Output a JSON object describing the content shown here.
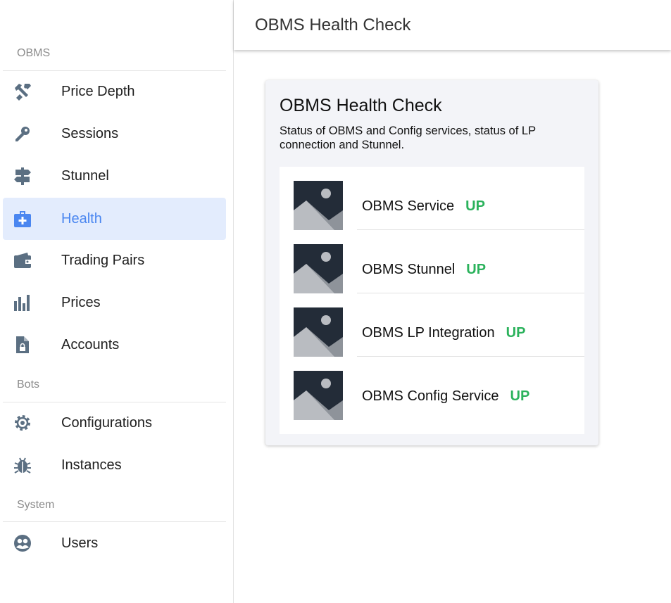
{
  "sidebar": {
    "sections": [
      {
        "title": "OBMS",
        "items": [
          {
            "label": "Price Depth",
            "icon": "tools-icon"
          },
          {
            "label": "Sessions",
            "icon": "key-icon"
          },
          {
            "label": "Stunnel",
            "icon": "signpost-icon"
          },
          {
            "label": "Health",
            "icon": "medical-bag-icon",
            "active": true
          },
          {
            "label": "Trading Pairs",
            "icon": "wallet-icon"
          },
          {
            "label": "Prices",
            "icon": "bar-chart-icon"
          },
          {
            "label": "Accounts",
            "icon": "file-lock-icon"
          }
        ]
      },
      {
        "title": "Bots",
        "items": [
          {
            "label": "Configurations",
            "icon": "gear-icon"
          },
          {
            "label": "Instances",
            "icon": "bug-icon"
          }
        ]
      },
      {
        "title": "System",
        "items": [
          {
            "label": "Users",
            "icon": "users-icon"
          }
        ]
      }
    ]
  },
  "header": {
    "title": "OBMS Health Check"
  },
  "card": {
    "title": "OBMS Health Check",
    "description": "Status of OBMS and Config services, status of LP connection and Stunnel.",
    "services": [
      {
        "name": "OBMS Service",
        "status": "UP",
        "icon": "image-placeholder-icon"
      },
      {
        "name": "OBMS Stunnel",
        "status": "UP",
        "icon": "image-placeholder-icon"
      },
      {
        "name": "OBMS LP Integration",
        "status": "UP",
        "icon": "image-placeholder-icon"
      },
      {
        "name": "OBMS Config Service",
        "status": "UP",
        "icon": "image-placeholder-icon"
      }
    ]
  },
  "colors": {
    "active_bg": "#e3ecfd",
    "active_text": "#4a86f0",
    "status_up": "#2bb25c",
    "icon": "#5b6f82"
  }
}
